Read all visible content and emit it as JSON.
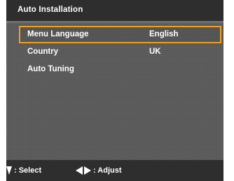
{
  "header": {
    "title": "Auto Installation"
  },
  "menu": {
    "items": [
      {
        "label": "Menu Language",
        "value": "English",
        "selected": true
      },
      {
        "label": "Country",
        "value": "UK",
        "selected": false
      },
      {
        "label": "Auto Tuning",
        "value": "",
        "selected": false
      }
    ]
  },
  "footer": {
    "select_hint": ": Select",
    "adjust_hint": ": Adjust",
    "select_icon": "up-down-arrows-icon",
    "adjust_icon": "left-right-arrows-icon"
  },
  "colors": {
    "highlight": "#f0a020",
    "background": "#5a5a5a",
    "bar": "#2e2e2e",
    "text": "#ffffff"
  }
}
